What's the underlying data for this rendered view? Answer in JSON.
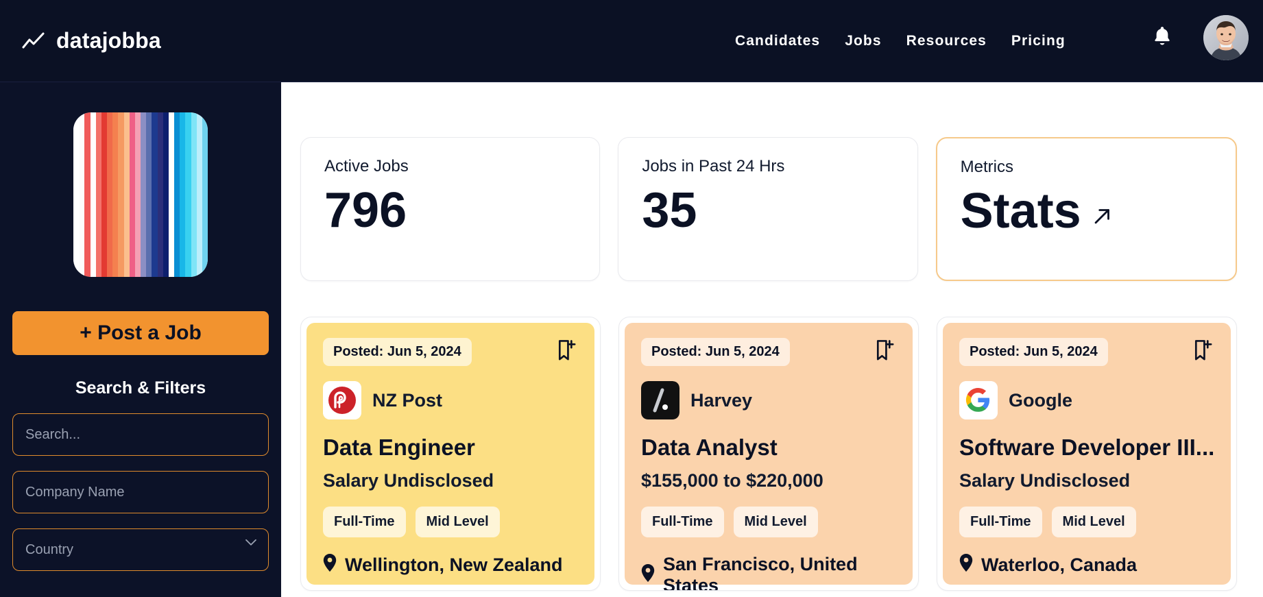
{
  "header": {
    "brand_name": "datajobba",
    "brand_icon": "line-chart-icon",
    "nav": [
      {
        "label": "Candidates"
      },
      {
        "label": "Jobs"
      },
      {
        "label": "Resources"
      },
      {
        "label": "Pricing"
      }
    ],
    "bell_icon": "notification-bell-icon",
    "avatar_icon": "user-avatar-photo"
  },
  "sidebar": {
    "logo_alt": "warming-stripes-logo",
    "logo_stripes": [
      "#ffffff",
      "#fdfdfd",
      "#f05a5a",
      "#ffffff",
      "#f4726a",
      "#e33a32",
      "#f06a4a",
      "#f4804f",
      "#f59a62",
      "#fbbf8e",
      "#ef5f86",
      "#f4a0b4",
      "#8c8fc4",
      "#5b6fae",
      "#1d3a8f",
      "#2b2f7a",
      "#0d1f6e",
      "#ffffff",
      "#0a8fd4",
      "#18b7e8",
      "#38d1f0",
      "#7fe4f7",
      "#bdeefb",
      "#6fd2ee"
    ],
    "post_job_label": "+ Post a Job",
    "filters_title": "Search & Filters",
    "search_placeholder": "Search...",
    "search_value": "",
    "company_placeholder": "Company Name",
    "company_value": "",
    "country_label": "Country",
    "country_chevron": "chevron-down-icon"
  },
  "stats": [
    {
      "label": "Active Jobs",
      "value": "796",
      "accent": false,
      "arrow": ""
    },
    {
      "label": "Jobs in Past 24 Hrs",
      "value": "35",
      "accent": false,
      "arrow": ""
    },
    {
      "label": "Metrics",
      "value": "Stats",
      "accent": true,
      "arrow": "arrow-up-right-icon"
    }
  ],
  "jobs": [
    {
      "posted": "Posted: Jun 5, 2024",
      "company": "NZ Post",
      "company_logo": "nz-post-logo",
      "title": "Data Engineer",
      "salary": "Salary Undisclosed",
      "tags": [
        "Full-Time",
        "Mid Level"
      ],
      "location": "Wellington, New Zealand",
      "bg": "#fcdf84",
      "bookmark_icon": "bookmark-add-icon",
      "pin_icon": "map-pin-icon"
    },
    {
      "posted": "Posted: Jun 5, 2024",
      "company": "Harvey",
      "company_logo": "harvey-logo",
      "title": "Data Analyst",
      "salary": "$155,000 to $220,000",
      "tags": [
        "Full-Time",
        "Mid Level"
      ],
      "location": "San Francisco, United States",
      "bg": "#fbd3ac",
      "bookmark_icon": "bookmark-add-icon",
      "pin_icon": "map-pin-icon"
    },
    {
      "posted": "Posted: Jun 5, 2024",
      "company": "Google",
      "company_logo": "google-logo",
      "title": "Software Developer III...",
      "salary": "Salary Undisclosed",
      "tags": [
        "Full-Time",
        "Mid Level"
      ],
      "location": "Waterloo, Canada",
      "bg": "#fbd3ac",
      "bookmark_icon": "bookmark-add-icon",
      "pin_icon": "map-pin-icon"
    }
  ],
  "colors": {
    "header_bg": "#0b1124",
    "sidebar_bg": "#0c1228",
    "accent_orange": "#f2932f",
    "accent_border": "#e08b2c",
    "stat_accent_border": "#f6c98a",
    "text_dark": "#0b1124",
    "page_bg": "#ffffff"
  }
}
